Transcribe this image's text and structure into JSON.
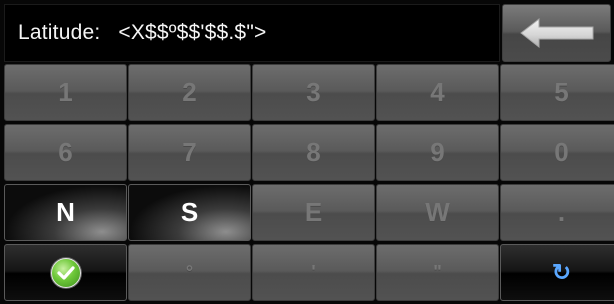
{
  "input": {
    "label": "Latitude:",
    "value": "<X$$º$$'$$.$\">"
  },
  "actions": {
    "backspace_icon": "arrow-left-icon",
    "confirm_icon": "checkmark-icon",
    "reset_icon": "refresh-icon"
  },
  "keypad": {
    "row1": [
      "1",
      "2",
      "3",
      "4",
      "5"
    ],
    "row2": [
      "6",
      "7",
      "8",
      "9",
      "0"
    ],
    "row3": [
      "N",
      "S",
      "E",
      "W",
      "."
    ],
    "row4": {
      "degree": "°",
      "minute": "'",
      "second": "\""
    }
  }
}
